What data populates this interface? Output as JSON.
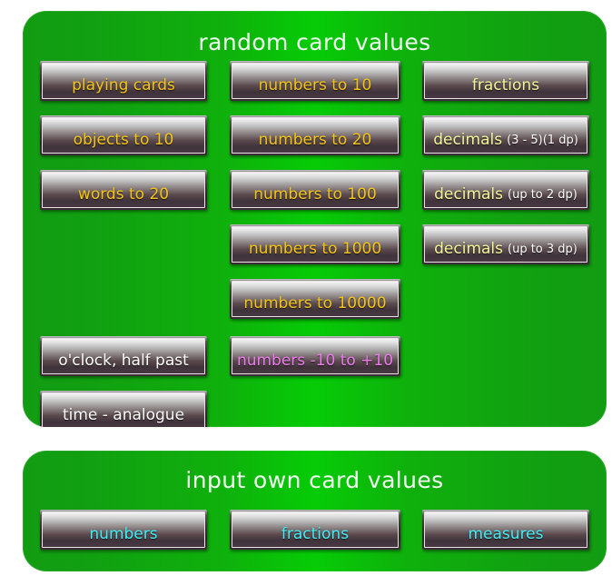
{
  "theme": {
    "panel_green_center": "#06cc06",
    "panel_green_edge": "#129c12",
    "gold": "#f5c518",
    "cream": "#f2f79a",
    "white": "#ffffff",
    "magenta": "#ee7bee",
    "cyan": "#3ff0f7"
  },
  "panels": [
    {
      "id": "random-card-values",
      "title": "random card values"
    },
    {
      "id": "input-own-card-values",
      "title": "input own card values"
    }
  ],
  "random_buttons": {
    "column1": [
      {
        "label": "playing cards",
        "sub": "",
        "color": "gold"
      },
      {
        "label": "objects to 10",
        "sub": "",
        "color": "gold"
      },
      {
        "label": "words to 20",
        "sub": "",
        "color": "gold"
      },
      {
        "label": "o'clock, half past",
        "sub": "",
        "color": "white"
      },
      {
        "label": "time - analogue",
        "sub": "",
        "color": "white"
      }
    ],
    "column2": [
      {
        "label": "numbers to 10",
        "sub": "",
        "color": "gold"
      },
      {
        "label": "numbers to 20",
        "sub": "",
        "color": "gold"
      },
      {
        "label": "numbers to 100",
        "sub": "",
        "color": "gold"
      },
      {
        "label": "numbers to 1000",
        "sub": "",
        "color": "gold"
      },
      {
        "label": "numbers to 10000",
        "sub": "",
        "color": "gold"
      },
      {
        "label": "numbers -10 to +10",
        "sub": "",
        "color": "magenta"
      }
    ],
    "column3": [
      {
        "label": "fractions",
        "sub": "",
        "color": "cream"
      },
      {
        "label": "decimals",
        "sub": "(3 - 5)(1 dp)",
        "color": "cream"
      },
      {
        "label": "decimals",
        "sub": "(up to 2 dp)",
        "color": "cream"
      },
      {
        "label": "decimals",
        "sub": "(up to 3 dp)",
        "color": "cream"
      }
    ]
  },
  "input_buttons": [
    {
      "label": "numbers",
      "color": "cyan"
    },
    {
      "label": "fractions",
      "color": "cyan"
    },
    {
      "label": "measures",
      "color": "cyan"
    }
  ]
}
